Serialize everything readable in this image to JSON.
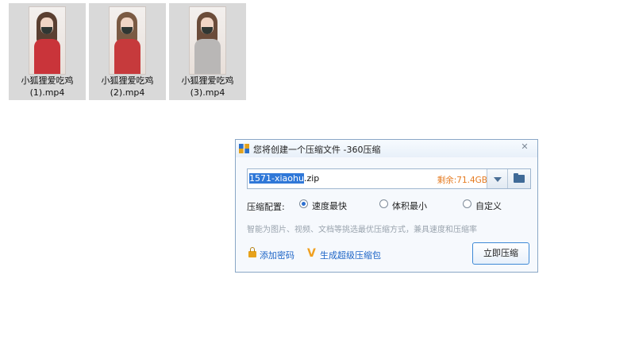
{
  "files": [
    {
      "name_line1": "小狐狸爱吃鸡",
      "name_line2": "(1).mp4",
      "outfit": "#c9343a"
    },
    {
      "name_line1": "小狐狸爱吃鸡",
      "name_line2": "(2).mp4",
      "outfit": "#c63a3c"
    },
    {
      "name_line1": "小狐狸爱吃鸡",
      "name_line2": "(3).mp4",
      "outfit": "#b9b7b6"
    }
  ],
  "dialog": {
    "title": "您将创建一个压缩文件 -360压缩",
    "close_glyph": "✕",
    "filename_selected": "1571-xiaohu",
    "filename_ext": ".zip",
    "free_space": "剩余:71.4GB",
    "config_label": "压缩配置:",
    "options": [
      {
        "label": "速度最快",
        "selected": true
      },
      {
        "label": "体积最小",
        "selected": false
      },
      {
        "label": "自定义",
        "selected": false
      }
    ],
    "hint": "智能为图片、视频、文档等挑选最优压缩方式，兼具速度和压缩率",
    "add_password": "添加密码",
    "create_sfx": "生成超级压缩包",
    "compress_now": "立即压缩"
  },
  "colors": {
    "accent": "#1c64c6",
    "free_space": "#e57a1f",
    "selection": "#3078d8"
  }
}
